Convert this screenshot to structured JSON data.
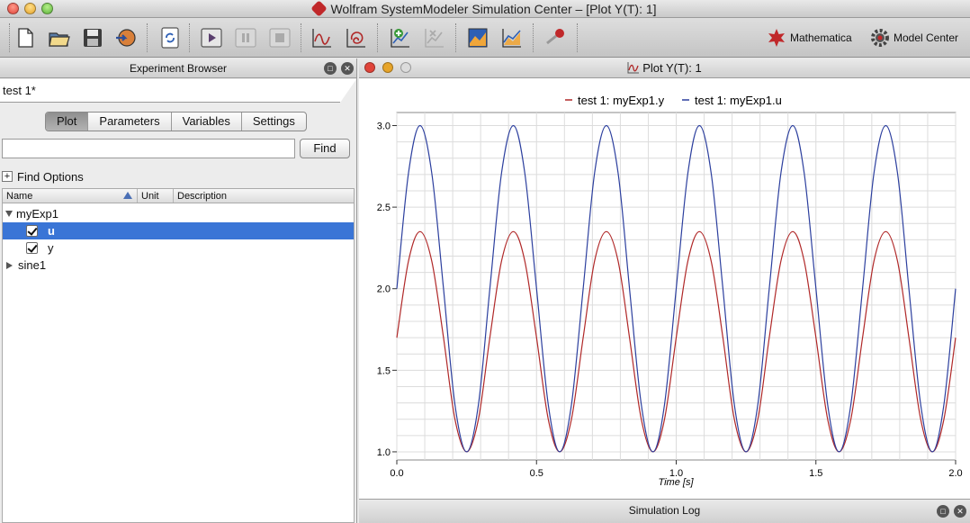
{
  "window": {
    "title": "Wolfram SystemModeler Simulation Center – [Plot Y(T): 1]",
    "controls": [
      "close",
      "minimize",
      "zoom"
    ]
  },
  "toolbar": {
    "left_icons": [
      "new-file-icon",
      "open-folder-icon",
      "save-icon",
      "import-icon",
      "reload-icon",
      "run-simulation-icon",
      "pause-icon",
      "stop-icon",
      "new-plot-icon",
      "parametric-plot-icon",
      "add-plot-variable-icon",
      "remove-plot-variable-icon",
      "plot-to-image-icon",
      "plot-settings-icon",
      "animation-icon"
    ],
    "mathematica_label": "Mathematica",
    "model_center_label": "Model Center"
  },
  "experiment_browser": {
    "title": "Experiment Browser",
    "document_tab": "test 1*",
    "tabs": [
      {
        "label": "Plot",
        "active": true
      },
      {
        "label": "Parameters",
        "active": false
      },
      {
        "label": "Variables",
        "active": false
      },
      {
        "label": "Settings",
        "active": false
      }
    ],
    "search": {
      "value": "",
      "placeholder": ""
    },
    "find_label": "Find",
    "find_options_label": "Find Options",
    "columns": {
      "name": "Name",
      "unit": "Unit",
      "description": "Description"
    },
    "tree": [
      {
        "label": "myExp1",
        "expanded": true,
        "children": [
          {
            "label": "u",
            "checked": true,
            "selected": true
          },
          {
            "label": "y",
            "checked": true,
            "selected": false
          }
        ]
      },
      {
        "label": "sine1",
        "expanded": false
      }
    ]
  },
  "plot_window": {
    "title": "Plot Y(T): 1",
    "colors": {
      "y": "#b02828",
      "u": "#2c3f9e",
      "grid": "#dcdcdc"
    },
    "chart_data": {
      "type": "line",
      "title": "",
      "xlabel": "Time [s]",
      "ylabel": "",
      "xlim": [
        0,
        2
      ],
      "ylim": [
        0.95,
        3.08
      ],
      "x_ticks": [
        "0.0",
        "0.5",
        "1.0",
        "1.5",
        "2.0"
      ],
      "y_ticks": [
        "1.0",
        "1.5",
        "2.0",
        "2.5",
        "3.0"
      ],
      "grid": true,
      "legend_position": "top-center",
      "series": [
        {
          "name": "test 1: myExp1.y",
          "color": "#b02828",
          "x": [
            0,
            0.042,
            0.083,
            0.125,
            0.167,
            0.208,
            0.25,
            0.292,
            0.333,
            0.375,
            0.417,
            0.458,
            0.5,
            0.542,
            0.583,
            0.625,
            0.667,
            0.708,
            0.75,
            0.792,
            0.833,
            0.875,
            0.917,
            0.958,
            1.0,
            1.042,
            1.083,
            1.125,
            1.167,
            1.208,
            1.25,
            1.292,
            1.333,
            1.375,
            1.417,
            1.458,
            1.5,
            1.542,
            1.583,
            1.625,
            1.667,
            1.708,
            1.75,
            1.792,
            1.833,
            1.875,
            1.917,
            1.958,
            2.0
          ],
          "y": [
            1.7,
            2.17,
            2.35,
            2.17,
            1.7,
            1.2,
            1.0,
            1.2,
            1.7,
            2.17,
            2.35,
            2.17,
            1.7,
            1.2,
            1.0,
            1.2,
            1.7,
            2.17,
            2.35,
            2.17,
            1.7,
            1.2,
            1.0,
            1.2,
            1.7,
            2.17,
            2.35,
            2.17,
            1.7,
            1.2,
            1.0,
            1.2,
            1.7,
            2.17,
            2.35,
            2.17,
            1.7,
            1.2,
            1.0,
            1.2,
            1.7,
            2.17,
            2.35,
            2.17,
            1.7,
            1.2,
            1.0,
            1.2,
            1.7
          ]
        },
        {
          "name": "test 1: myExp1.u",
          "color": "#2c3f9e",
          "x": [
            0,
            0.042,
            0.083,
            0.125,
            0.167,
            0.208,
            0.25,
            0.292,
            0.333,
            0.375,
            0.417,
            0.458,
            0.5,
            0.542,
            0.583,
            0.625,
            0.667,
            0.708,
            0.75,
            0.792,
            0.833,
            0.875,
            0.917,
            0.958,
            1.0,
            1.042,
            1.083,
            1.125,
            1.167,
            1.208,
            1.25,
            1.292,
            1.333,
            1.375,
            1.417,
            1.458,
            1.5,
            1.542,
            1.583,
            1.625,
            1.667,
            1.708,
            1.75,
            1.792,
            1.833,
            1.875,
            1.917,
            1.958,
            2.0
          ],
          "y": [
            2.0,
            2.71,
            3.0,
            2.71,
            2.0,
            1.29,
            1.0,
            1.29,
            2.0,
            2.71,
            3.0,
            2.71,
            2.0,
            1.29,
            1.0,
            1.29,
            2.0,
            2.71,
            3.0,
            2.71,
            2.0,
            1.29,
            1.0,
            1.29,
            2.0,
            2.71,
            3.0,
            2.71,
            2.0,
            1.29,
            1.0,
            1.29,
            2.0,
            2.71,
            3.0,
            2.71,
            2.0,
            1.29,
            1.0,
            1.29,
            2.0,
            2.71,
            3.0,
            2.71,
            2.0,
            1.29,
            1.0,
            1.29,
            2.0
          ]
        }
      ]
    }
  },
  "simulation_log": {
    "title": "Simulation Log"
  }
}
